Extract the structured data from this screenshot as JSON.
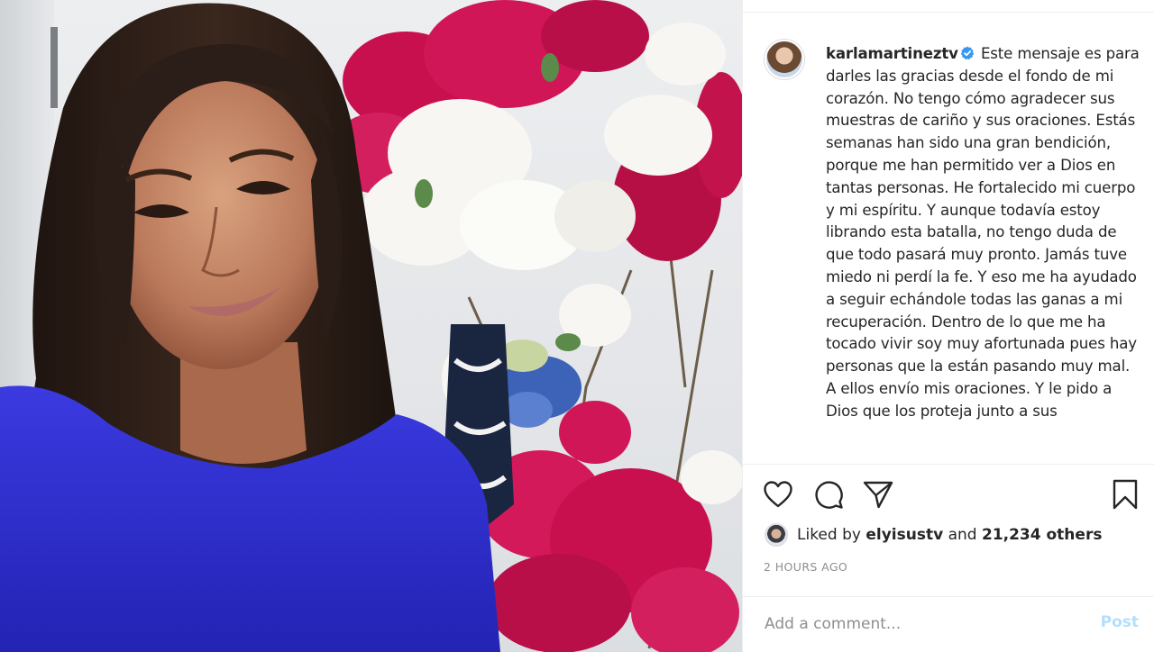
{
  "post": {
    "username": "karlamartineztv",
    "verified": true,
    "caption": "Este mensaje es para darles las gracias desde el fondo de mi corazón. No tengo cómo agradecer sus muestras de cariño y sus oraciones. Estás semanas han sido una gran bendición, porque me han permitido ver a Dios en tantas personas. He fortalecido mi cuerpo y mi espíritu. Y aunque todavía estoy librando esta batalla, no tengo duda de que todo pasará muy pronto. Jamás tuve miedo ni perdí la fe. Y eso me ha ayudado a seguir echándole todas las ganas a mi recuperación. Dentro de lo que me ha tocado vivir soy muy afortunada pues hay personas que la están pasando muy mal. A ellos envío mis oraciones. Y le pido a Dios que los proteja junto a sus",
    "likes": {
      "prefix": "Liked by",
      "user": "elyisustv",
      "conjunction": "and",
      "others": "21,234 others"
    },
    "timestamp": "2 HOURS AGO"
  },
  "actions": {
    "like_icon": "heart-icon",
    "comment_icon": "comment-icon",
    "share_icon": "paper-plane-icon",
    "save_icon": "bookmark-icon"
  },
  "comment": {
    "placeholder": "Add a comment...",
    "post_label": "Post"
  },
  "colors": {
    "text": "#262626",
    "muted": "#8e8e8e",
    "verified": "#3897f0",
    "post_disabled": "#b2dffc",
    "sweater": "#2f2fd0",
    "flower_magenta": "#c8104f",
    "hair": "#2b1d17"
  }
}
